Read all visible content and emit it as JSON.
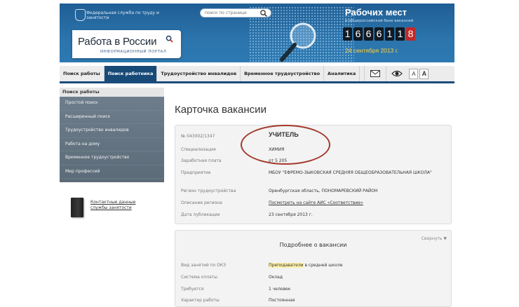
{
  "header": {
    "service_name": "Федеральная служба по труду и занятости",
    "logo_title": "Работа в России",
    "logo_subtitle": "ИНФОРМАЦИОННЫЙ ПОРТАЛ",
    "search_placeholder": "поиск по странице",
    "counter_title": "Рабочих мест",
    "counter_subtitle": "в общероссийской базе вакансий",
    "counter_digits": [
      "1",
      "6",
      "6",
      "6",
      "1",
      "1",
      "8"
    ],
    "counter_date": "24 сентября 2013 г."
  },
  "nav": {
    "items": [
      {
        "label": "Поиск работы",
        "active": false
      },
      {
        "label": "Поиск работника",
        "active": true
      },
      {
        "label": "Трудоустройство инвалидов",
        "active": false
      },
      {
        "label": "Временное трудоустройство",
        "active": false
      },
      {
        "label": "Аналитика",
        "active": false
      }
    ],
    "font_small": "A",
    "font_large": "A"
  },
  "sidebar": {
    "heading": "Поиск работы",
    "items": [
      {
        "label": "Простой поиск"
      },
      {
        "label": "Расширенный поиск"
      },
      {
        "label": "Трудоустройство инвалидов"
      },
      {
        "label": "Работа на дому"
      },
      {
        "label": "Временное трудоустройство"
      },
      {
        "label": "Мир профессий"
      }
    ],
    "contact_link": "Контактные данные службы занятости"
  },
  "main": {
    "title": "Карточка вакансии",
    "vacancy": {
      "number": "№ 043002/1347",
      "position": "УЧИТЕЛЬ",
      "specialization_label": "Специализация",
      "specialization": "ХИМИЯ",
      "salary_label": "Заработная плата",
      "salary": "от 5 205",
      "employer_label": "Предприятие",
      "employer": "МБОУ \"ЕФРЕМО-ЗЫКОВСКАЯ СРЕДНЯЯ ОБЩЕОБРАЗОВАТЕЛЬНАЯ ШКОЛА\"",
      "region_label": "Регион трудоустройства",
      "region": "Оренбургская область, ПОНОМАРЕВСКИЙ РАЙОН",
      "region_desc_label": "Описание региона",
      "region_desc_link": "Посмотреть на сайте АИС «Соответствие»",
      "published_label": "Дата публикации",
      "published": "23 сентября 2013 г."
    },
    "details": {
      "title": "Подробнее о вакансии",
      "collapse": "Свернуть ▼",
      "okz_label": "Вид занятий по ОКЗ",
      "okz_highlight": "Преподаватели",
      "okz_rest": " в средней школе",
      "pay_system_label": "Система оплаты",
      "pay_system": "Оклад",
      "required_label": "Требуется",
      "required": "1 человек",
      "work_type_label": "Характер работы",
      "work_type": "Постоянная"
    }
  }
}
